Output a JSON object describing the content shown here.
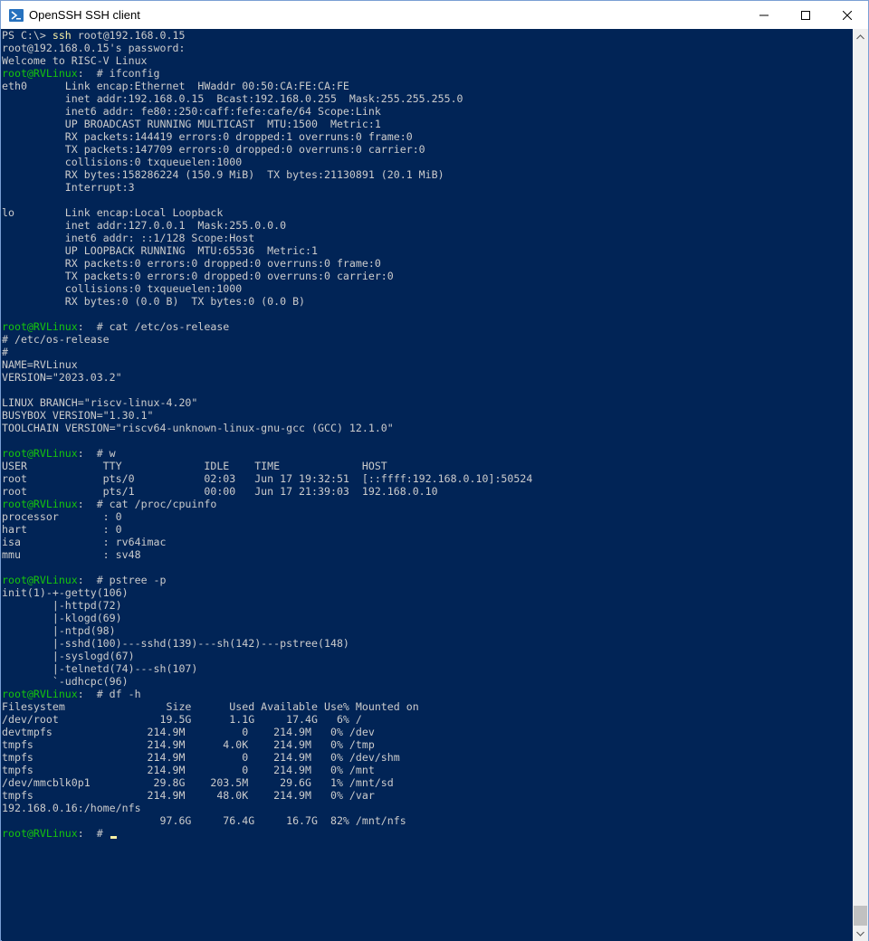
{
  "window": {
    "title": "OpenSSH SSH client",
    "icon": "powershell-icon",
    "buttons": {
      "minimize": "minimize-icon",
      "maximize": "maximize-icon",
      "close": "close-icon"
    }
  },
  "colors": {
    "console_bg": "#012456",
    "console_text": "#cccccc",
    "prompt_host": "#16c60c",
    "command_highlight": "#f9f1a5"
  },
  "terminal": {
    "ps_prompt": "PS C:\\> ",
    "ssh_cmd": "ssh",
    "ssh_args": " root@192.168.0.15",
    "prompt_user": "root@RVLinux",
    "prompt_suffix": ":  # ",
    "lines": [
      "root@192.168.0.15's password:",
      "Welcome to RISC-V Linux",
      "eth0      Link encap:Ethernet  HWaddr 00:50:CA:FE:CA:FE",
      "          inet addr:192.168.0.15  Bcast:192.168.0.255  Mask:255.255.255.0",
      "          inet6 addr: fe80::250:caff:fefe:cafe/64 Scope:Link",
      "          UP BROADCAST RUNNING MULTICAST  MTU:1500  Metric:1",
      "          RX packets:144419 errors:0 dropped:1 overruns:0 frame:0",
      "          TX packets:147709 errors:0 dropped:0 overruns:0 carrier:0",
      "          collisions:0 txqueuelen:1000",
      "          RX bytes:158286224 (150.9 MiB)  TX bytes:21130891 (20.1 MiB)",
      "          Interrupt:3",
      "",
      "lo        Link encap:Local Loopback",
      "          inet addr:127.0.0.1  Mask:255.0.0.0",
      "          inet6 addr: ::1/128 Scope:Host",
      "          UP LOOPBACK RUNNING  MTU:65536  Metric:1",
      "          RX packets:0 errors:0 dropped:0 overruns:0 frame:0",
      "          TX packets:0 errors:0 dropped:0 overruns:0 carrier:0",
      "          collisions:0 txqueuelen:1000",
      "          RX bytes:0 (0.0 B)  TX bytes:0 (0.0 B)",
      "",
      "# /etc/os-release",
      "#",
      "NAME=RVLinux",
      "VERSION=\"2023.03.2\"",
      "",
      "LINUX BRANCH=\"riscv-linux-4.20\"",
      "BUSYBOX VERSION=\"1.30.1\"",
      "TOOLCHAIN VERSION=\"riscv64-unknown-linux-gnu-gcc (GCC) 12.1.0\"",
      "",
      "USER            TTY             IDLE    TIME             HOST",
      "root            pts/0           02:03   Jun 17 19:32:51  [::ffff:192.168.0.10]:50524",
      "root            pts/1           00:00   Jun 17 21:39:03  192.168.0.10",
      "processor       : 0",
      "hart            : 0",
      "isa             : rv64imac",
      "mmu             : sv48",
      "",
      "init(1)-+-getty(106)",
      "        |-httpd(72)",
      "        |-klogd(69)",
      "        |-ntpd(98)",
      "        |-sshd(100)---sshd(139)---sh(142)---pstree(148)",
      "        |-syslogd(67)",
      "        |-telnetd(74)---sh(107)",
      "        `-udhcpc(96)",
      "Filesystem                Size      Used Available Use% Mounted on",
      "/dev/root                19.5G      1.1G     17.4G   6% /",
      "devtmpfs               214.9M         0    214.9M   0% /dev",
      "tmpfs                  214.9M      4.0K    214.9M   0% /tmp",
      "tmpfs                  214.9M         0    214.9M   0% /dev/shm",
      "tmpfs                  214.9M         0    214.9M   0% /mnt",
      "/dev/mmcblk0p1          29.8G    203.5M     29.6G   1% /mnt/sd",
      "tmpfs                  214.9M     48.0K    214.9M   0% /var",
      "192.168.0.16:/home/nfs",
      "                         97.6G     76.4G     16.7G  82% /mnt/nfs"
    ],
    "commands": {
      "ifconfig": "ifconfig",
      "os_release": "cat /etc/os-release",
      "w": "w",
      "cpuinfo": "cat /proc/cpuinfo",
      "pstree": "pstree -p",
      "df": "df -h"
    }
  },
  "scrollbar": {
    "up_icon": "chevron-up-icon",
    "down_icon": "chevron-down-icon"
  }
}
